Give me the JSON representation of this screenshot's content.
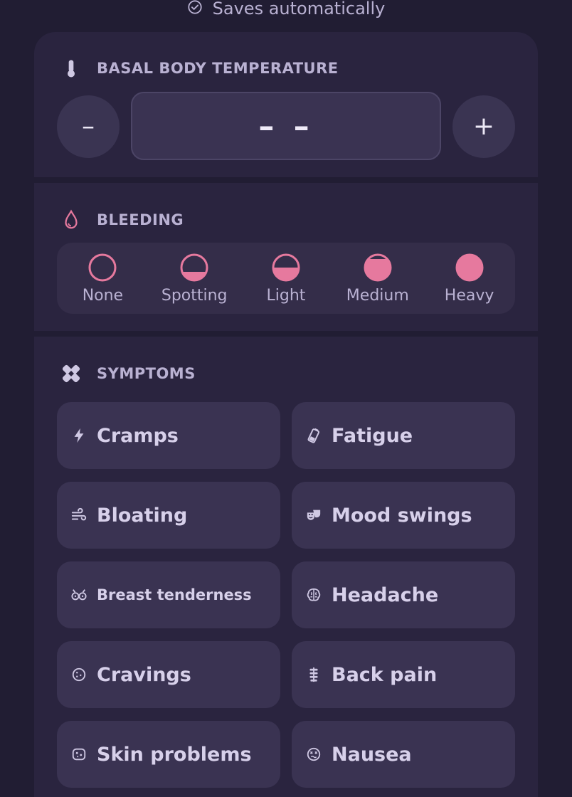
{
  "status": {
    "text": "Saves automatically",
    "icon": "check-circle-icon"
  },
  "colors": {
    "background": "#211d33",
    "panel": "#2a243f",
    "accent": "#e6799e",
    "text": "#d7d0ea"
  },
  "temperature": {
    "title": "BASAL BODY TEMPERATURE",
    "icon": "thermometer-icon",
    "decrement_label": "–",
    "increment_label": "+",
    "value": "– –"
  },
  "bleeding": {
    "title": "BLEEDING",
    "icon": "droplet-icon",
    "options": [
      {
        "label": "None",
        "fill": 0
      },
      {
        "label": "Spotting",
        "fill": 0.3
      },
      {
        "label": "Light",
        "fill": 0.5
      },
      {
        "label": "Medium",
        "fill": 0.8
      },
      {
        "label": "Heavy",
        "fill": 1
      }
    ]
  },
  "symptoms": {
    "title": "SYMPTOMS",
    "icon": "bandage-icon",
    "items": [
      {
        "label": "Cramps",
        "icon": "bolt-icon"
      },
      {
        "label": "Fatigue",
        "icon": "battery-low-icon"
      },
      {
        "label": "Bloating",
        "icon": "wind-icon"
      },
      {
        "label": "Mood swings",
        "icon": "masks-icon"
      },
      {
        "label": "Breast tenderness",
        "icon": "breast-icon"
      },
      {
        "label": "Headache",
        "icon": "brain-icon"
      },
      {
        "label": "Cravings",
        "icon": "cookie-icon"
      },
      {
        "label": "Back pain",
        "icon": "spine-icon"
      },
      {
        "label": "Skin problems",
        "icon": "skin-icon"
      },
      {
        "label": "Nausea",
        "icon": "dizzy-face-icon"
      }
    ]
  }
}
